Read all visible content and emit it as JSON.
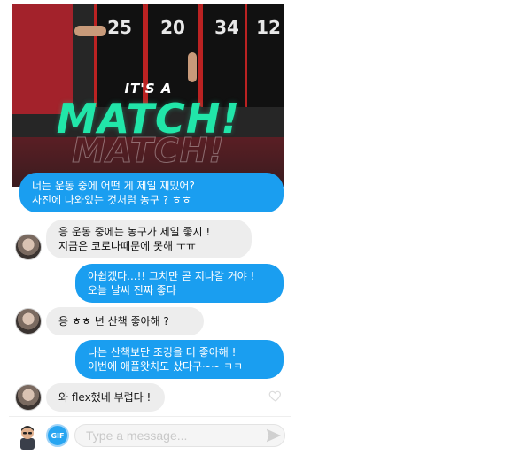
{
  "match_card": {
    "its_a": "IT'S A",
    "title": "MATCH!",
    "jersey_numbers": [
      "25",
      "20",
      "34",
      "12"
    ],
    "colors": {
      "match_green": "#21e6a9"
    }
  },
  "messages": [
    {
      "side": "sent",
      "lines": [
        "너는 운동 중에 어떤 게 제일 재밌어?",
        "사진에 나와있는 것처럼 농구 ? ㅎㅎ"
      ]
    },
    {
      "side": "received",
      "lines": [
        "응 운동 중에는 농구가 제일 좋지 !",
        "지금은 코로나때문에 못해 ㅜㅠ"
      ]
    },
    {
      "side": "sent",
      "lines": [
        "아쉽겠다...!! 그치만 곧 지나갈 거야 !",
        "오늘 날씨 진짜 좋다"
      ]
    },
    {
      "side": "received",
      "lines": [
        "응 ㅎㅎ 넌 산책 좋아해 ?"
      ]
    },
    {
      "side": "sent",
      "lines": [
        "나는 산책보단 조깅을 더 좋아해 !",
        "이번에 애플왓치도 샀다구~~ ㅋㅋ"
      ]
    },
    {
      "side": "received",
      "lines": [
        "와 flex했네 부럽다 !"
      ]
    }
  ],
  "composer": {
    "gif_label": "GIF",
    "placeholder": "Type a message..."
  },
  "colors": {
    "sent_bubble": "#1a9ef0",
    "received_bubble": "#ededed",
    "accent": "#27a5f1"
  }
}
